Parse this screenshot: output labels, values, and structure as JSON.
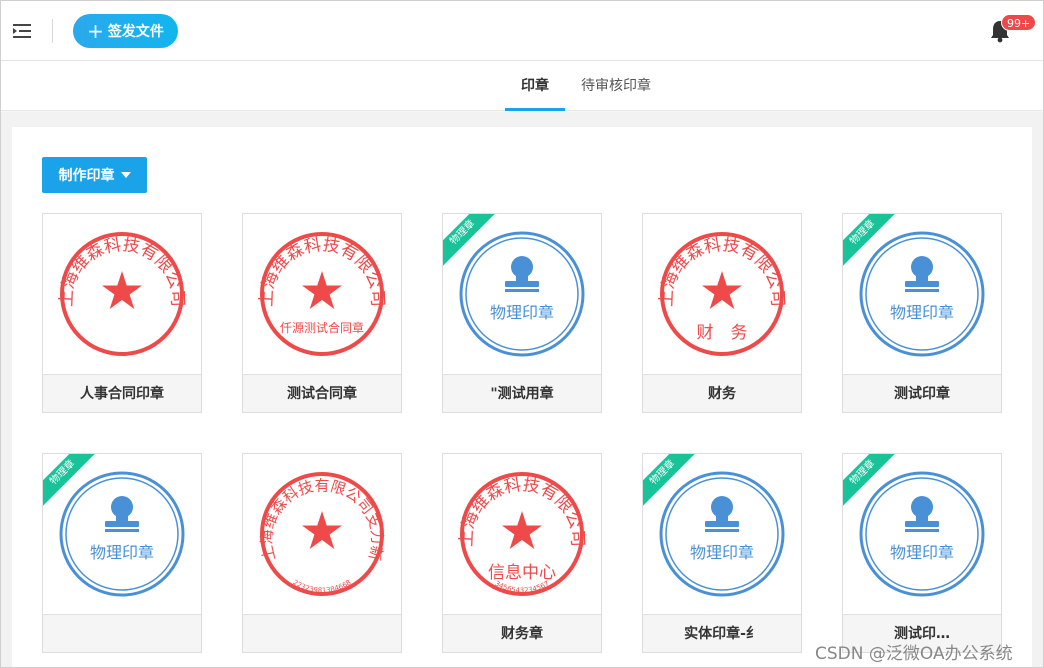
{
  "header": {
    "issue_button": "签发文件",
    "badge": "99+"
  },
  "tabs": [
    {
      "label": "印章",
      "active": true
    },
    {
      "label": "待审核印章",
      "active": false
    }
  ],
  "toolbar": {
    "make_seal": "制作印章"
  },
  "colors": {
    "red_seal": "#ef4a4a",
    "blue_seal": "#4a90d6",
    "accent": "#1aa3e8",
    "ribbon": "#19c39a"
  },
  "ribbon_label": "物理章",
  "physical_seal_text": "物理印章",
  "seals": [
    {
      "caption": "人事合同印章",
      "kind": "red",
      "arc": "上海维森科技有限公司",
      "center": "",
      "sub": ""
    },
    {
      "caption": "测试合同章",
      "kind": "red",
      "arc": "上海维森科技有限公司",
      "center": "仟源测试合同章",
      "sub": ""
    },
    {
      "caption": "\"测试用章",
      "kind": "blue",
      "ribbon": true
    },
    {
      "caption": "财务",
      "kind": "red",
      "arc": "上海维森科技有限公司",
      "center": "财　务",
      "sub": ""
    },
    {
      "caption": "测试印章",
      "kind": "blue",
      "ribbon": true
    },
    {
      "caption": "",
      "kind": "blue",
      "ribbon": true
    },
    {
      "caption": "",
      "kind": "red",
      "arc": "上海维森科技有限公司支力新",
      "center": "",
      "sub": "22323981384668"
    },
    {
      "caption": "财务章",
      "kind": "red",
      "arc": "上海维森科技有限公司",
      "center": "信息中心",
      "sub": "3456543234567"
    },
    {
      "caption": "实体印章-纟",
      "kind": "blue",
      "ribbon": true
    },
    {
      "caption": "测试印…",
      "kind": "blue",
      "ribbon": true
    }
  ],
  "watermark": "CSDN @泛微OA办公系统"
}
